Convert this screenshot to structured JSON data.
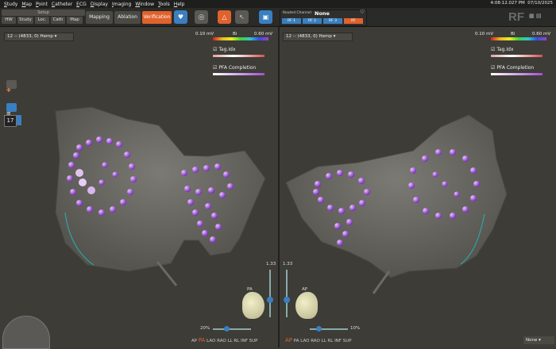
{
  "menu": [
    "Study",
    "Map",
    "Point",
    "Catheter",
    "ECG",
    "Display",
    "Imaging",
    "Window",
    "Tools",
    "Help"
  ],
  "clock": {
    "time": "4:08:12.027 PM",
    "date": "07/10/2025",
    "brand": "RF"
  },
  "workflow": {
    "setup": "Setup",
    "sub_tabs": [
      "HW",
      "Study",
      "Loc.",
      "Cath",
      "Map"
    ],
    "tabs": [
      "Mapping",
      "Ablation",
      "Verification"
    ],
    "active": "Verification"
  },
  "routed_channel": {
    "label": "Routed Channel",
    "value": "None",
    "channels": [
      "RF 1",
      "RF 2",
      "RF 3",
      "RF"
    ]
  },
  "left_view": {
    "map_selector": "12 -- (4833, 0) Hemp",
    "scale_min": "0.10 mV",
    "scale_mid": "Bi",
    "scale_max": "0.60 mV",
    "tag_label": "Tag.Idx",
    "pfa_label": "PFA Completion",
    "zoom_value": "1.33",
    "orientation": "PA",
    "percent": "20%",
    "views": [
      "AP",
      "PA",
      "LAO",
      "RAO",
      "LL",
      "RL",
      "INF",
      "SUP"
    ],
    "active_view": "PA"
  },
  "right_view": {
    "map_selector": "12 -- (4833, 0) Hemp",
    "scale_min": "0.10 mV",
    "scale_mid": "Bi",
    "scale_max": "0.60 mV",
    "tag_label": "Tag.Idx",
    "pfa_label": "PFA Completion",
    "zoom_value": "1.33",
    "orientation": "AP",
    "percent": "10%",
    "views": [
      "AP",
      "PA",
      "LAO",
      "RAO",
      "LL",
      "RL",
      "INF",
      "SUP"
    ],
    "active_view": "AP"
  },
  "side_counter": "17",
  "bottom_right_select": "None",
  "colors": {
    "accent": "#e0622c",
    "panel": "#3d3c37",
    "anatomy": "#6b6a65",
    "ablation": "#9a4fd6"
  }
}
